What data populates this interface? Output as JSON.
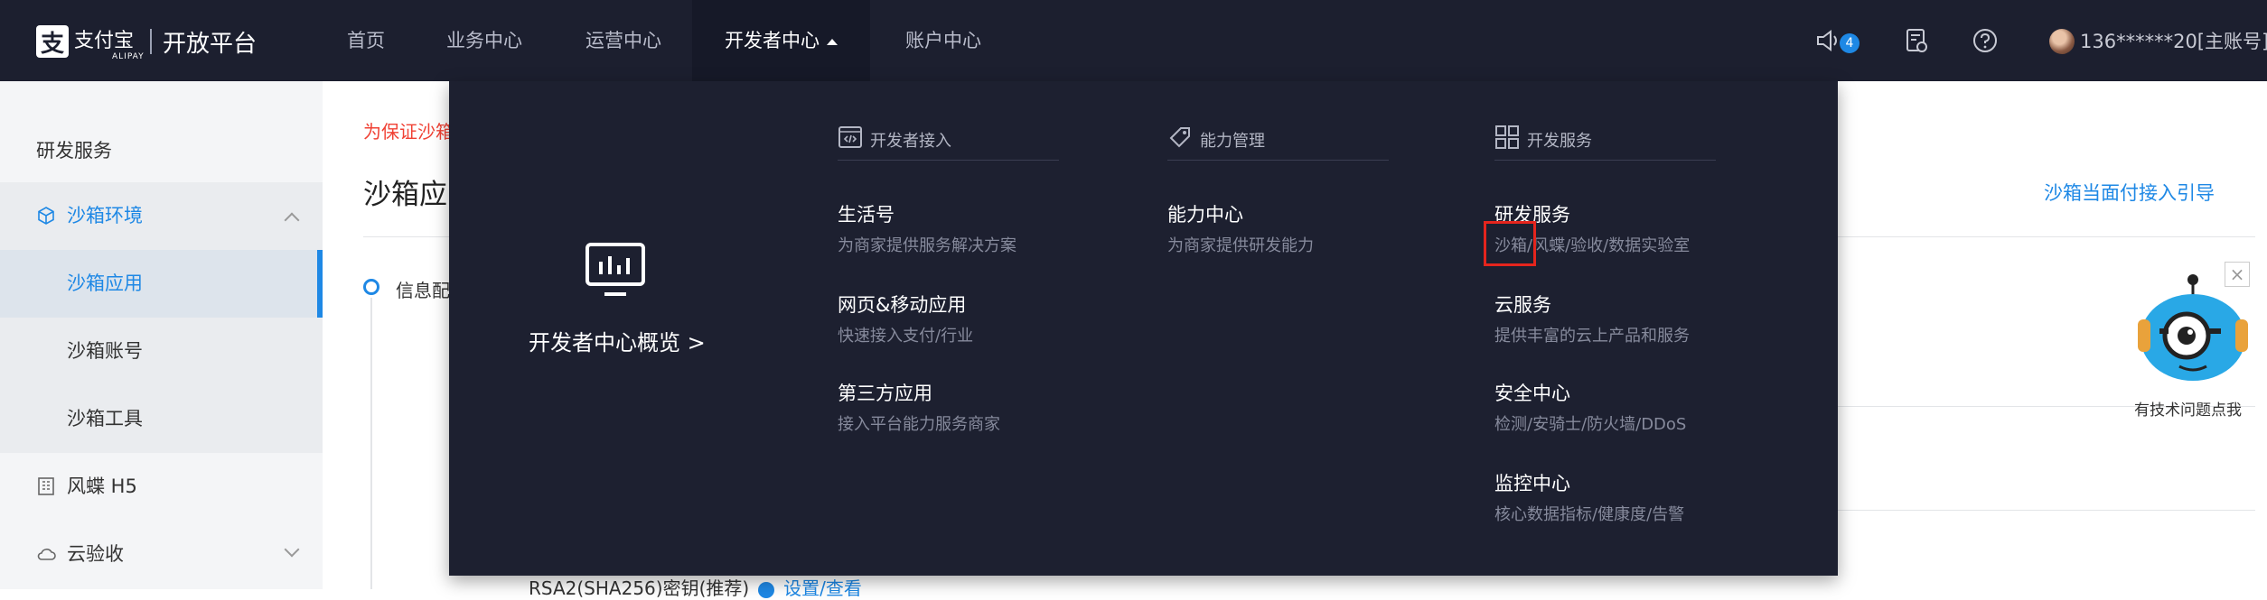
{
  "brand": {
    "logo_glyph": "支",
    "name": "支付宝",
    "sub": "ALIPAY",
    "platform": "开放平台"
  },
  "nav": {
    "items": [
      {
        "label": "首页"
      },
      {
        "label": "业务中心"
      },
      {
        "label": "运营中心"
      },
      {
        "label": "开发者中心",
        "active": true
      },
      {
        "label": "账户中心"
      }
    ]
  },
  "topright": {
    "notification_count": "4",
    "account": "136******20[主账号]",
    "icons": [
      "speaker-icon",
      "document-icon",
      "help-icon"
    ]
  },
  "sidebar": {
    "items": [
      {
        "label": "研发服务",
        "type": "heading"
      },
      {
        "label": "沙箱环境",
        "type": "group",
        "icon": "cube-icon",
        "expanded": true
      },
      {
        "label": "沙箱应用",
        "type": "sub",
        "active": true
      },
      {
        "label": "沙箱账号",
        "type": "sub"
      },
      {
        "label": "沙箱工具",
        "type": "sub"
      },
      {
        "label": "风蝶 H5",
        "type": "item",
        "icon": "building-icon"
      },
      {
        "label": "云验收",
        "type": "item",
        "icon": "cloud-icon",
        "expanded": false
      }
    ]
  },
  "main": {
    "notice": "为保证沙箱",
    "title": "沙箱应",
    "guide_link": "沙箱当面付接入引导",
    "step_label": "信息配",
    "rsa_label": "RSA2(SHA256)密钥(推荐)",
    "rsa_link": "设置/查看"
  },
  "mascot": {
    "caption": "有技术问题点我",
    "close": "×"
  },
  "dropdown": {
    "overview": {
      "title": "开发者中心概览 >"
    },
    "columns": [
      {
        "heading": "开发者接入",
        "icon": "code-window-icon",
        "entries": [
          {
            "title": "生活号",
            "desc": "为商家提供服务解决方案"
          },
          {
            "title": "网页&移动应用",
            "desc": "快速接入支付/行业"
          },
          {
            "title": "第三方应用",
            "desc": "接入平台能力服务商家"
          }
        ]
      },
      {
        "heading": "能力管理",
        "icon": "tag-icon",
        "entries": [
          {
            "title": "能力中心",
            "desc": "为商家提供研发能力"
          }
        ]
      },
      {
        "heading": "开发服务",
        "icon": "grid-icon",
        "entries": [
          {
            "title": "研发服务",
            "desc": "沙箱/风蝶/验收/数据实验室"
          },
          {
            "title": "云服务",
            "desc": "提供丰富的云上产品和服务"
          },
          {
            "title": "安全中心",
            "desc": "检测/安骑士/防火墙/DDoS"
          },
          {
            "title": "监控中心",
            "desc": "核心数据指标/健康度/告警"
          }
        ]
      }
    ]
  },
  "colors": {
    "topbar": "#1c1f2f",
    "dropdown": "#1d2030",
    "accent": "#1e88e5",
    "alert": "#f04134",
    "highlight_box": "#e5251d"
  }
}
